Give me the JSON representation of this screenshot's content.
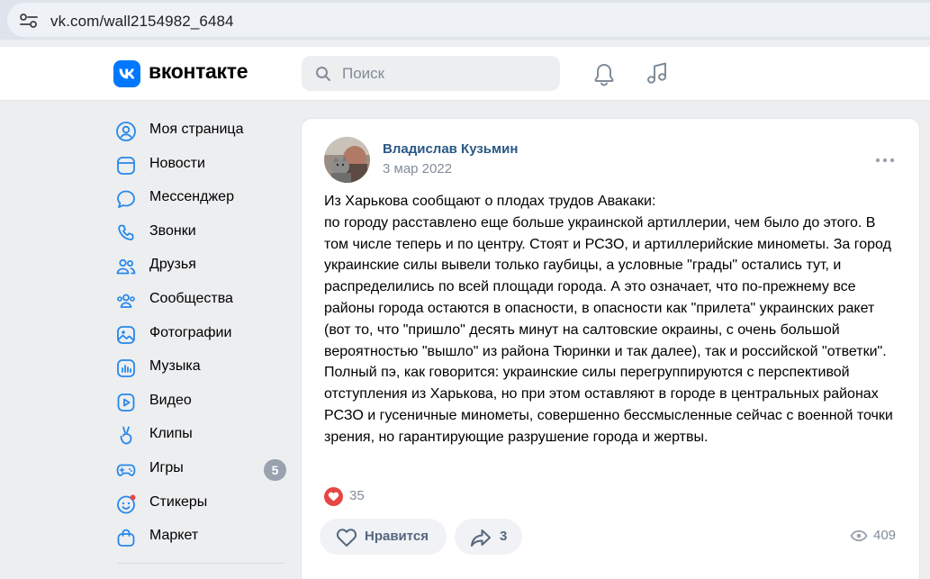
{
  "browser": {
    "url": "vk.com/wall2154982_6484"
  },
  "header": {
    "logo_text": "вконтакте",
    "search_placeholder": "Поиск"
  },
  "sidebar": {
    "items": [
      {
        "label": "Моя страница",
        "icon": "profile-icon"
      },
      {
        "label": "Новости",
        "icon": "news-icon"
      },
      {
        "label": "Мессенджер",
        "icon": "messenger-icon"
      },
      {
        "label": "Звонки",
        "icon": "phone-icon"
      },
      {
        "label": "Друзья",
        "icon": "friends-icon"
      },
      {
        "label": "Сообщества",
        "icon": "communities-icon"
      },
      {
        "label": "Фотографии",
        "icon": "photos-icon"
      },
      {
        "label": "Музыка",
        "icon": "music-icon"
      },
      {
        "label": "Видео",
        "icon": "video-icon"
      },
      {
        "label": "Клипы",
        "icon": "clips-icon"
      },
      {
        "label": "Игры",
        "icon": "games-icon",
        "badge": "5"
      },
      {
        "label": "Стикеры",
        "icon": "stickers-icon"
      },
      {
        "label": "Маркет",
        "icon": "market-icon"
      }
    ]
  },
  "post": {
    "author": "Владислав Кузьмин",
    "date": "3 мар 2022",
    "text": "Из Харькова сообщают о плодах трудов Авакаки:\nпо городу расставлено еще больше украинской артиллерии, чем было до этого. В том числе теперь и по центру. Стоят и РСЗО, и артиллерийские минометы. За город украинские силы вывели только гаубицы, а условные \"грады\" остались тут, и распределились по всей площади города. А это означает, что по-прежнему все районы города остаются в опасности, в опасности как \"прилета\" украинских ракет (вот то, что \"пришло\" десять минут на салтовские окраины, с очень большой вероятностью \"вышло\" из района Тюринки и так далее), так и российской \"ответки\". Полный пэ, как говорится: украинские силы перегруппируются с перспективой отступления из Харькова, но при этом оставляют в городе в центральных районах РСЗО и гусеничные минометы, совершенно бессмысленные сейчас с военной точки зрения, но гарантирующие разрушение города и жертвы.",
    "reactions_count": "35",
    "like_label": "Нравится",
    "share_count": "3",
    "views_count": "409"
  },
  "colors": {
    "accent": "#0077ff",
    "link": "#2a5885",
    "secondary_text": "#818c99",
    "heart": "#e64646"
  }
}
